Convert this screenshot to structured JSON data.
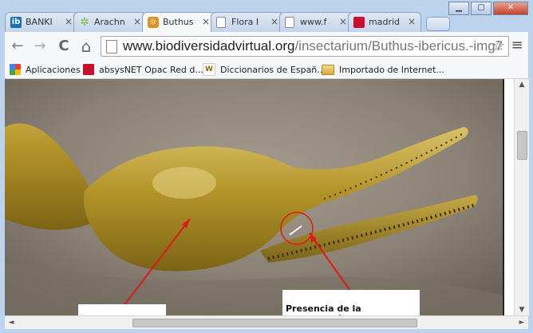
{
  "window": {
    "controls": {
      "minimize": "▁",
      "maximize": "▢",
      "close": "✕"
    }
  },
  "tabs": [
    {
      "title": "BANKI",
      "fav_color": "#1b6fb7",
      "fav_text": "ib"
    },
    {
      "title": "Arachn",
      "fav_color": "#7bc043",
      "fav_text": "✲"
    },
    {
      "title": "Buthus",
      "fav_color": "#e0902b",
      "fav_text": "☼",
      "active": true
    },
    {
      "title": "Flora I",
      "fav_color": "#ffffff",
      "fav_text": ""
    },
    {
      "title": "www.f",
      "fav_color": "#ffffff",
      "fav_text": ""
    },
    {
      "title": "madrid",
      "fav_color": "#c8102e",
      "fav_text": ""
    }
  ],
  "tab_close": "×",
  "toolbar": {
    "back": "←",
    "forward": "→",
    "reload": "C",
    "home": "⌂",
    "url_host": "www.biodiversidadvirtual.org",
    "url_path": "/insectarium/Buthus-ibericus.-img7",
    "star": "☆",
    "menu": "≡"
  },
  "bookmarks": [
    {
      "label": "Aplicaciones",
      "icon_color": "#e94235"
    },
    {
      "label": "absysNET Opac Red d...",
      "icon_color": "#c8102e"
    },
    {
      "label": "Diccionarios de Españ...",
      "icon_color": "#f5c518"
    },
    {
      "label": "Importado de Internet...",
      "icon_color": "#e6b84a"
    }
  ],
  "page": {
    "caption_right": "Presencia de la combinación",
    "caption_left": ""
  },
  "scrollbars": {
    "up": "▲",
    "down": "▼",
    "left": "◄",
    "right": "►"
  },
  "colors": {
    "scorpion_body": "#a88a22",
    "scorpion_highlight": "#d8c16a",
    "rock": "#8f867a",
    "annotation": "#e01818"
  }
}
